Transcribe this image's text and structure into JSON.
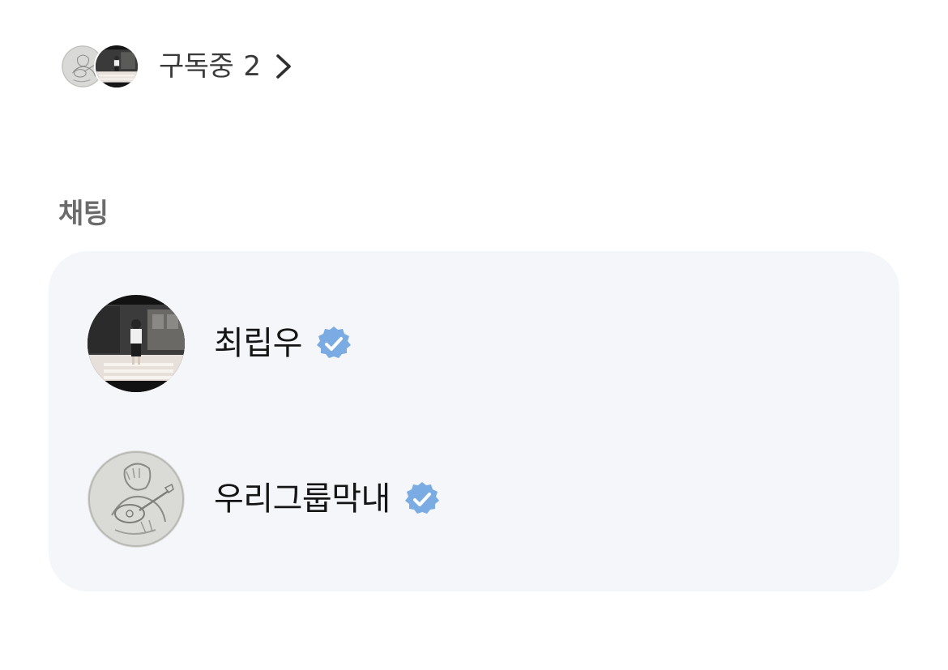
{
  "subscriptions": {
    "label": "구독중",
    "count": "2",
    "avatars": [
      {
        "icon": "sketch-guitar-avatar"
      },
      {
        "icon": "street-photo-avatar"
      }
    ]
  },
  "chat_section": {
    "title": "채팅",
    "items": [
      {
        "name": "최립우",
        "verified": true,
        "avatar": "street-photo-avatar"
      },
      {
        "name": "우리그룹막내",
        "verified": true,
        "avatar": "sketch-guitar-avatar"
      }
    ]
  },
  "colors": {
    "card_background": "#f4f6f9",
    "verified_badge": "#7aace3",
    "section_title": "#6b6b6b",
    "text": "#151515"
  }
}
